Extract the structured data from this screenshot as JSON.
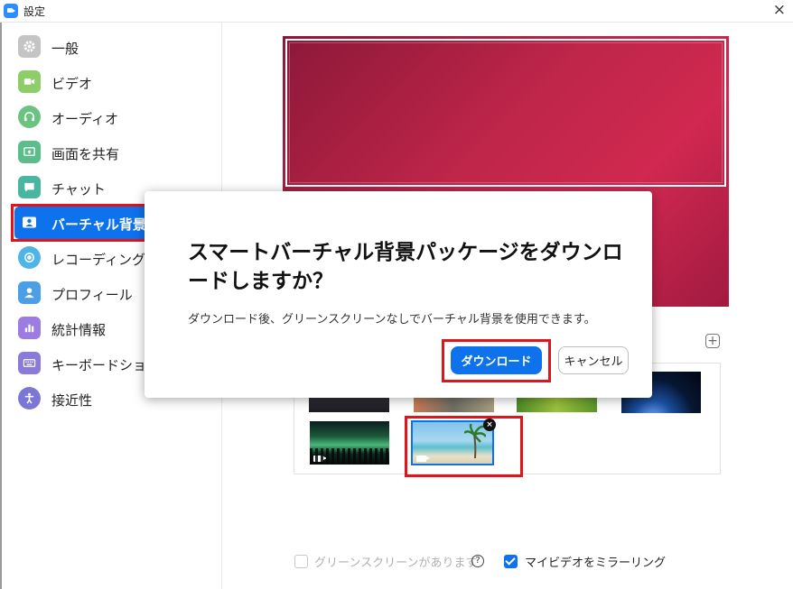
{
  "window": {
    "title": "設定",
    "close_glyph": "×"
  },
  "sidebar": {
    "items": [
      {
        "label": "一般",
        "icon": "gear-icon",
        "color": "#b9b9b9"
      },
      {
        "label": "ビデオ",
        "icon": "video-camera-icon",
        "color": "#8fcc6a"
      },
      {
        "label": "オーディオ",
        "icon": "headphones-icon",
        "color": "#6cc381"
      },
      {
        "label": "画面を共有",
        "icon": "share-screen-icon",
        "color": "#5cbd8a"
      },
      {
        "label": "チャット",
        "icon": "chat-bubble-icon",
        "color": "#49b6a1"
      },
      {
        "label": "バーチャル背景",
        "icon": "virtual-background-icon",
        "color": "#ffffff",
        "selected": true
      },
      {
        "label": "レコーディングして",
        "icon": "record-icon",
        "color": "#4fb4e8"
      },
      {
        "label": "プロフィール",
        "icon": "profile-icon",
        "color": "#4b9fe6"
      },
      {
        "label": "統計情報",
        "icon": "statistics-icon",
        "color": "#9c7be2"
      },
      {
        "label": "キーボードショート",
        "icon": "keyboard-icon",
        "color": "#8b7ad9"
      },
      {
        "label": "接近性",
        "icon": "accessibility-icon",
        "color": "#7b77d6"
      }
    ]
  },
  "dialog": {
    "title": "スマートバーチャル背景パッケージをダウンロードしますか？",
    "body": "ダウンロード後、グリーンスクリーンなしでバーチャル背景を使用できます。",
    "primary_label": "ダウンロード",
    "secondary_label": "キャンセル"
  },
  "backgrounds": {
    "add_glyph": "+",
    "remove_glyph": "×"
  },
  "options": {
    "green_screen_label": "グリーンスクリーンがあります",
    "green_screen_checked": false,
    "help_glyph": "?",
    "mirror_label": "マイビデオをミラーリング",
    "mirror_checked": true
  },
  "colors": {
    "accent": "#0e72ed",
    "highlight": "#e0141b",
    "preview": "#c0264a"
  }
}
